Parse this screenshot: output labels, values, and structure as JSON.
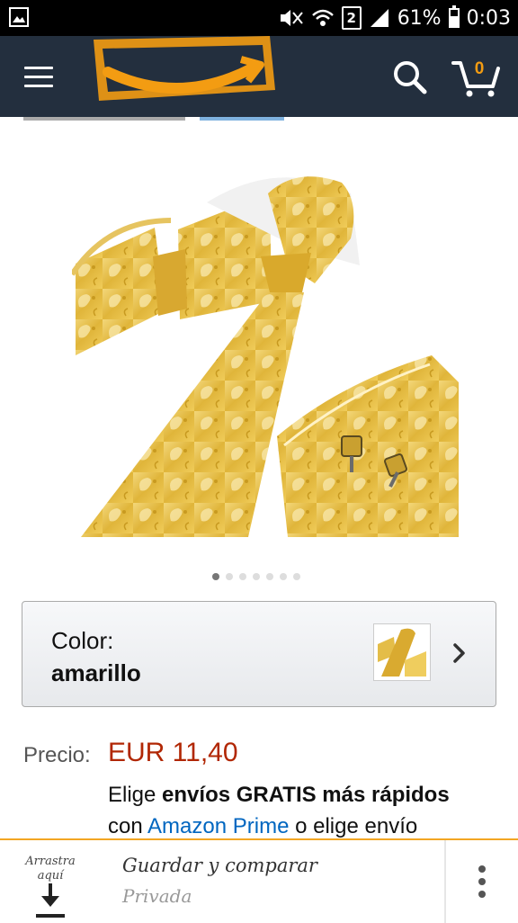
{
  "status_bar": {
    "sim_slot": "2",
    "battery_level": "61%",
    "battery_fraction": 0.61,
    "time": "0:03"
  },
  "header": {
    "cart_count": "0",
    "colors": {
      "bar": "#232f3e",
      "accent": "#f39c12"
    }
  },
  "carousel": {
    "total": 7,
    "active_index": 0
  },
  "variation": {
    "label": "Color:",
    "value": "amarillo"
  },
  "price": {
    "label": "Precio:",
    "value": "EUR 11,40",
    "color": "#b12704"
  },
  "shipping": {
    "part1": "Elige ",
    "bold": "envíos GRATIS más rápidos",
    "part2": " con ",
    "prime_link": "Amazon Prime",
    "part3": " o elige envío"
  },
  "bottom_bar": {
    "drag_label": "Arrastra aquí",
    "title": "Guardar y comparar",
    "subtitle": "Privada"
  }
}
